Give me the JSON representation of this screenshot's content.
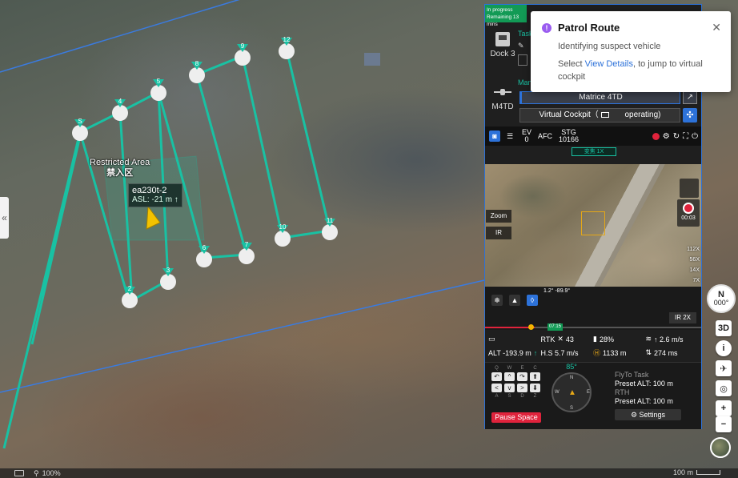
{
  "map": {
    "restricted_area_en": "Restricted Area",
    "restricted_area_cn": "禁入区",
    "drone_name": "ea230t-2",
    "drone_asl": "ASL: -21 m ↑",
    "waypoints": [
      "12",
      "9",
      "8",
      "5",
      "4",
      "S",
      "3",
      "2",
      "6",
      "7",
      "10",
      "11"
    ],
    "collapse_icon": "«",
    "zoom_level": "100%",
    "scale_text": "100 m",
    "compass_letter": "N",
    "compass_heading": "000°",
    "controls": [
      "3D",
      "i",
      "plane-icon",
      "locate-icon",
      "+",
      "−"
    ],
    "route_color": "#19c1a3"
  },
  "panel": {
    "status": "In progress",
    "remaining": "Remaining 13 mins",
    "dock_name": "Dock 3",
    "task_label": "Task",
    "drone_model": "M4TD",
    "manage_label": "Man",
    "device_select": "Matrice 4TD",
    "virtual_cockpit": "Virtual Cockpit（",
    "virtual_cockpit_suffix": "operating)",
    "toolbar": {
      "ev_label": "EV",
      "ev_value": "0",
      "afc": "AFC",
      "storage_label": "STG",
      "storage_value": "10166"
    },
    "mode_chip": "变焦 1X",
    "cam_side": {
      "zoom": "Zoom",
      "ir": "IR"
    },
    "rec_time": "00:03",
    "zoom_ticks": [
      "112X",
      "56X",
      "14X",
      "7X",
      "3X",
      "1X"
    ],
    "gimbal": "1.2° -89.9°",
    "ir_zoom": "IR 2X",
    "timeline_tag": "07:15",
    "telemetry": {
      "rtk": "RTK",
      "rtk_count": "43",
      "battery": "28%",
      "vspeed": "↑ 2.6 m/s",
      "alt": "ALT -193.9 m",
      "hspeed": "H.S 5.7 m/s",
      "home_dist": "1133 m",
      "dist": "274 ms"
    },
    "keypad": {
      "top_labels": [
        "Q",
        "W",
        "E",
        "C"
      ],
      "bottom_labels": [
        "A",
        "S",
        "D",
        "Z"
      ]
    },
    "pause": "Pause Space",
    "attitude_angle": "85°",
    "flyto": {
      "title": "FlyTo Task",
      "preset1": "Preset ALT: 100 m",
      "rth": "RTH",
      "preset2": "Preset ALT: 100 m"
    },
    "settings": "Settings"
  },
  "notification": {
    "title": "Patrol Route",
    "line1": "Identifying suspect vehicle",
    "select_text": "Select ",
    "link_text": "View Details",
    "after_link": ", to jump to virtual cockpit",
    "accent": "#9a5cf0"
  }
}
